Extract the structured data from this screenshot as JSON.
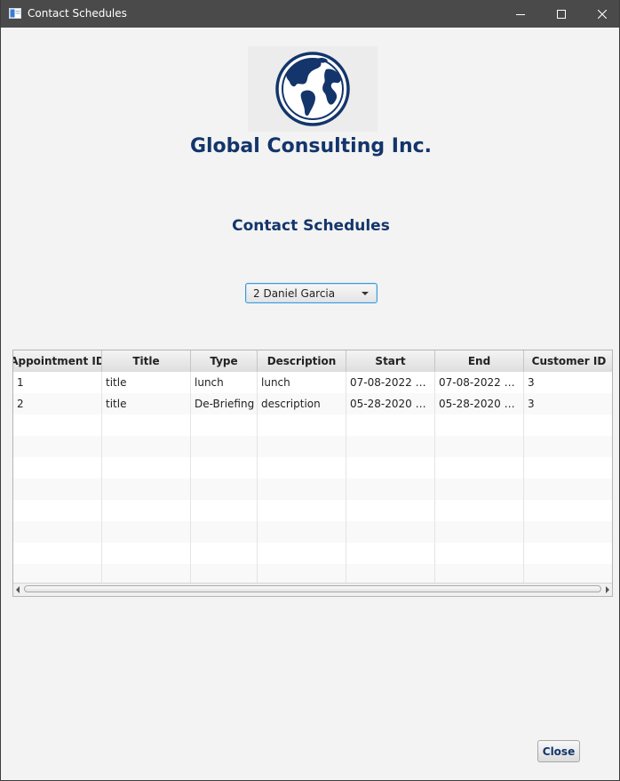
{
  "window": {
    "title": "Contact Schedules",
    "icon": "app-window-icon",
    "controls": [
      "minimize-icon",
      "maximize-icon",
      "close-icon"
    ]
  },
  "header": {
    "logo_icon": "globe-icon",
    "company_name": "Global Consulting Inc.",
    "heading": "Contact Schedules"
  },
  "contact_select": {
    "selected": "2 Daniel Garcia"
  },
  "table": {
    "columns": [
      "Appointment ID",
      "Title",
      "Type",
      "Description",
      "Start",
      "End",
      "Customer ID"
    ],
    "rows": [
      [
        "1",
        "title",
        "lunch",
        "lunch",
        "07-08-2022 @ …",
        "07-08-2022 @ …",
        "3"
      ],
      [
        "2",
        "title",
        "De-Briefing",
        "description",
        "05-28-2020 @ …",
        "05-28-2020 @ …",
        "3"
      ]
    ]
  },
  "footer": {
    "close_label": "Close"
  },
  "colors": {
    "brand_navy": "#13356b",
    "titlebar": "#4a4a4a",
    "background": "#f3f3f3",
    "focus_blue": "#3c9ad6"
  }
}
